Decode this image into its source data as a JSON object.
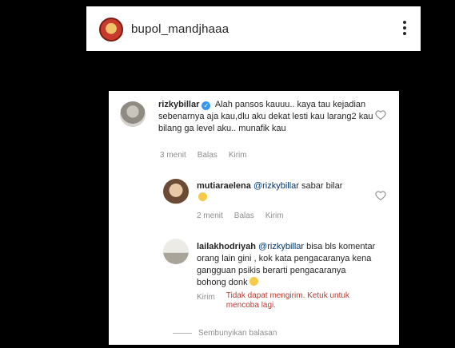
{
  "header": {
    "username": "bupol_mandjhaaa"
  },
  "comments": [
    {
      "username": "rizkybillar",
      "text": "Alah pansos kauuu.. kaya tau kejadian sebenarnya aja kau,dlu aku dekat lesti kau larang2 kau bilang ga level aku.. munafik kau",
      "time": "3 menit",
      "reply_label": "Balas",
      "send_label": "Kirim"
    },
    {
      "username": "mutiaraelena",
      "mention": "@rizkybillar",
      "text": "sabar bilar",
      "time": "2 menit",
      "reply_label": "Balas",
      "send_label": "Kirim"
    },
    {
      "username": "lailakhodriyah",
      "mention": "@rizkybillar",
      "text": "bisa bls komentar orang lain gini , kok kata pengacaranya kena gangguan psikis berarti pengacaranya bohong donk",
      "send_label": "Kirim",
      "error": "Tidak dapat mengirim. Ketuk untuk mencoba lagi."
    }
  ],
  "hide_replies_label": "Sembunyikan balasan",
  "colors": {
    "mention": "#00376b",
    "error": "#c0392b",
    "verified": "#3897f0"
  }
}
